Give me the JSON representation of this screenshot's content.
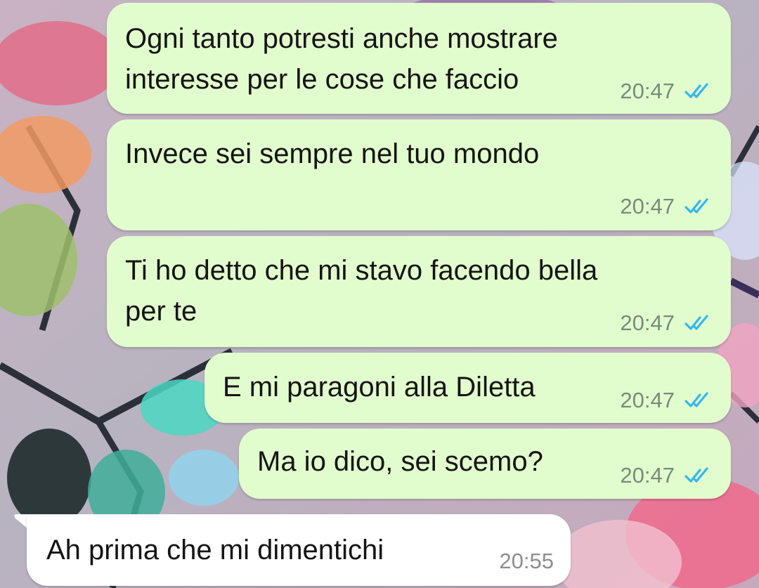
{
  "chat": {
    "messages": [
      {
        "direction": "outgoing",
        "text": "Ogni tanto potresti anche mostrare\ninteresse per le cose che faccio",
        "time": "20:47",
        "status": "read",
        "status_icon": "double-check-icon"
      },
      {
        "direction": "outgoing",
        "text": "Invece sei sempre nel tuo mondo",
        "time": "20:47",
        "status": "read",
        "status_icon": "double-check-icon"
      },
      {
        "direction": "outgoing",
        "text": "Ti ho detto che mi stavo facendo bella\nper te",
        "time": "20:47",
        "status": "read",
        "status_icon": "double-check-icon"
      },
      {
        "direction": "outgoing",
        "text": "E mi paragoni alla Diletta",
        "time": "20:47",
        "status": "read",
        "status_icon": "double-check-icon"
      },
      {
        "direction": "outgoing",
        "text": "Ma io dico, sei scemo?",
        "time": "20:47",
        "status": "read",
        "status_icon": "double-check-icon"
      },
      {
        "direction": "incoming",
        "text": "Ah prima che mi dimentichi",
        "time": "20:55"
      }
    ]
  },
  "colors": {
    "outgoing_bubble": "#e2fdcd",
    "incoming_bubble": "#ffffff",
    "read_tick": "#34b7f1",
    "time_text": "#7b8a7b"
  }
}
